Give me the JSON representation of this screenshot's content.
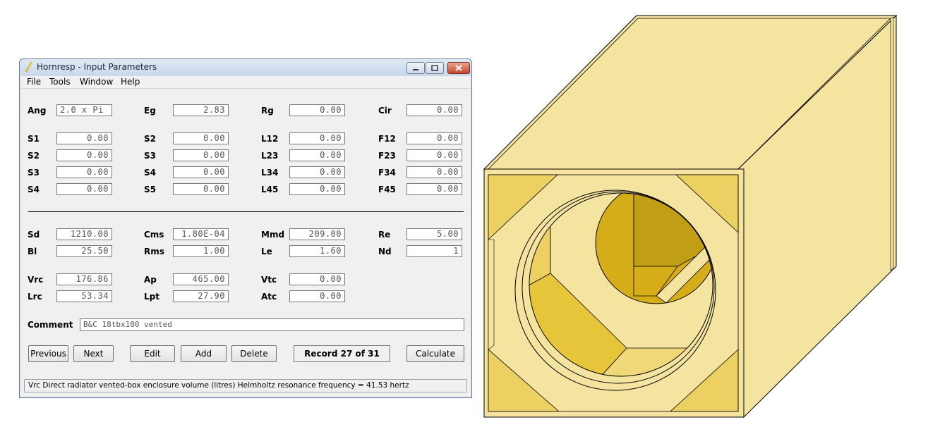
{
  "window": {
    "title": "Hornresp - Input Parameters"
  },
  "menu": [
    "File",
    "Tools",
    "Window",
    "Help"
  ],
  "params": {
    "row0": [
      {
        "label": "Ang",
        "value": "2.0 x Pi"
      },
      {
        "label": "Eg",
        "value": "2.83"
      },
      {
        "label": "Rg",
        "value": "0.00"
      },
      {
        "label": "Cir",
        "value": "0.00"
      }
    ],
    "row1": [
      {
        "label": "S1",
        "value": "0.00"
      },
      {
        "label": "S2",
        "value": "0.00"
      },
      {
        "label": "L12",
        "value": "0.00"
      },
      {
        "label": "F12",
        "value": "0.00"
      }
    ],
    "row2": [
      {
        "label": "S2",
        "value": "0.00"
      },
      {
        "label": "S3",
        "value": "0.00"
      },
      {
        "label": "L23",
        "value": "0.00"
      },
      {
        "label": "F23",
        "value": "0.00"
      }
    ],
    "row3": [
      {
        "label": "S3",
        "value": "0.00"
      },
      {
        "label": "S4",
        "value": "0.00"
      },
      {
        "label": "L34",
        "value": "0.00"
      },
      {
        "label": "F34",
        "value": "0.00"
      }
    ],
    "row4": [
      {
        "label": "S4",
        "value": "0.00"
      },
      {
        "label": "S5",
        "value": "0.00"
      },
      {
        "label": "L45",
        "value": "0.00"
      },
      {
        "label": "F45",
        "value": "0.00"
      }
    ],
    "row5": [
      {
        "label": "Sd",
        "value": "1210.00"
      },
      {
        "label": "Cms",
        "value": "1.80E-04"
      },
      {
        "label": "Mmd",
        "value": "209.00"
      },
      {
        "label": "Re",
        "value": "5.00"
      }
    ],
    "row6": [
      {
        "label": "Bl",
        "value": "25.50"
      },
      {
        "label": "Rms",
        "value": "1.00"
      },
      {
        "label": "Le",
        "value": "1.60"
      },
      {
        "label": "Nd",
        "value": "1"
      }
    ],
    "row7": [
      {
        "label": "Vrc",
        "value": "176.86"
      },
      {
        "label": "Ap",
        "value": "465.00"
      },
      {
        "label": "Vtc",
        "value": "0.00"
      }
    ],
    "row8": [
      {
        "label": "Lrc",
        "value": "53.34"
      },
      {
        "label": "Lpt",
        "value": "27.90"
      },
      {
        "label": "Atc",
        "value": "0.00"
      }
    ]
  },
  "comment": {
    "label": "Comment",
    "value": "B&C 18tbx100 vented"
  },
  "buttons": {
    "previous": "Previous",
    "next": "Next",
    "edit": "Edit",
    "add": "Add",
    "delete": "Delete",
    "calculate": "Calculate"
  },
  "record": "Record 27 of 31",
  "status": "Vrc   Direct radiator vented-box enclosure volume  (litres)   Helmholtz resonance frequency = 41.53 hertz",
  "colors": {
    "wood_light": "#f5e4a0",
    "wood_mid": "#ecd061",
    "wood_dark": "#d4ad19",
    "wood_darkest": "#c29d16"
  }
}
